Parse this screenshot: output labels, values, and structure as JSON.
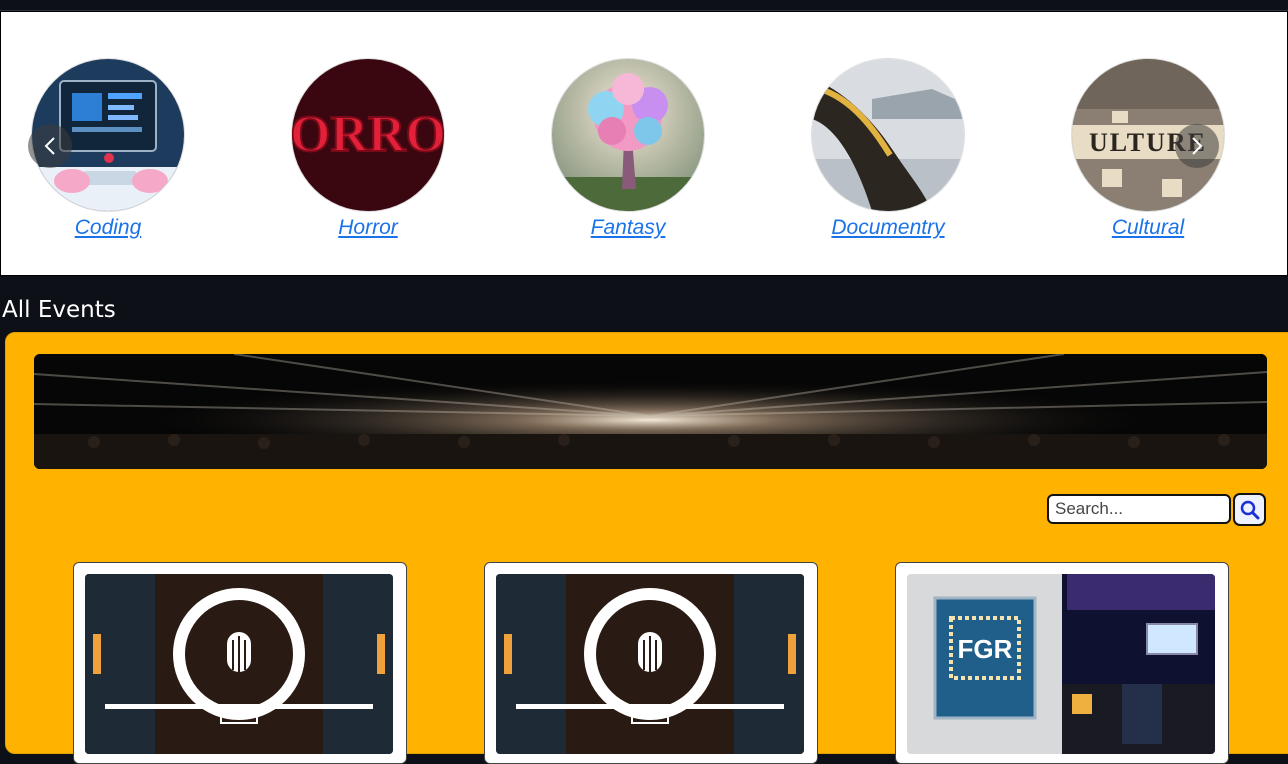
{
  "categories": [
    {
      "label": "Coding"
    },
    {
      "label": "Horror",
      "art_text": "ORRO"
    },
    {
      "label": "Fantasy"
    },
    {
      "label": "Documentry"
    },
    {
      "label": "Cultural",
      "art_text": "ULTURE"
    }
  ],
  "section": {
    "title": "All Events"
  },
  "search": {
    "placeholder": "Search..."
  },
  "event_cards": [
    {
      "poster": "cinema-logo-poster"
    },
    {
      "poster": "cinema-logo-poster"
    },
    {
      "poster": "fgr-poster",
      "art_text": "FGR"
    }
  ],
  "colors": {
    "page_bg": "#0d1117",
    "panel_bg": "#ffb300",
    "link": "#1a73e8"
  }
}
